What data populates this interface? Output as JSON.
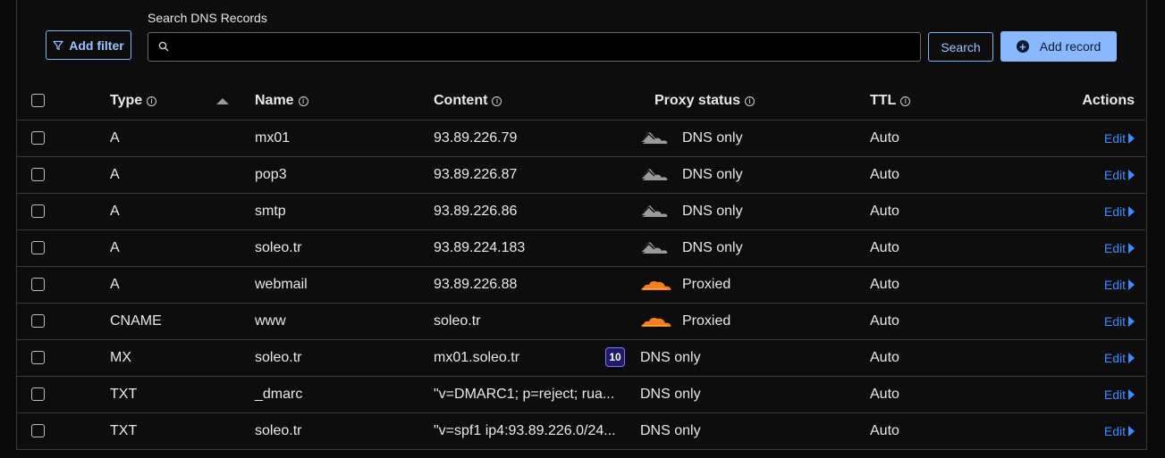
{
  "toolbar": {
    "search_label": "Search DNS Records",
    "filter_label": "Add filter",
    "search_button": "Search",
    "add_record_label": "Add record",
    "search_value": "",
    "search_placeholder": ""
  },
  "columns": {
    "type": "Type",
    "name": "Name",
    "content": "Content",
    "proxy_status": "Proxy status",
    "ttl": "TTL",
    "actions": "Actions"
  },
  "rows": [
    {
      "type": "A",
      "name": "mx01",
      "content": "93.89.226.79",
      "proxy": "DNS only",
      "proxy_icon": "cloud-gray",
      "ttl": "Auto",
      "action": "Edit"
    },
    {
      "type": "A",
      "name": "pop3",
      "content": "93.89.226.87",
      "proxy": "DNS only",
      "proxy_icon": "cloud-gray",
      "ttl": "Auto",
      "action": "Edit"
    },
    {
      "type": "A",
      "name": "smtp",
      "content": "93.89.226.86",
      "proxy": "DNS only",
      "proxy_icon": "cloud-gray",
      "ttl": "Auto",
      "action": "Edit"
    },
    {
      "type": "A",
      "name": "soleo.tr",
      "content": "93.89.224.183",
      "proxy": "DNS only",
      "proxy_icon": "cloud-gray",
      "ttl": "Auto",
      "action": "Edit"
    },
    {
      "type": "A",
      "name": "webmail",
      "content": "93.89.226.88",
      "proxy": "Proxied",
      "proxy_icon": "cloud-orange",
      "ttl": "Auto",
      "action": "Edit"
    },
    {
      "type": "CNAME",
      "name": "www",
      "content": "soleo.tr",
      "proxy": "Proxied",
      "proxy_icon": "cloud-orange",
      "ttl": "Auto",
      "action": "Edit"
    },
    {
      "type": "MX",
      "name": "soleo.tr",
      "content": "mx01.soleo.tr",
      "priority": "10",
      "proxy": "DNS only",
      "proxy_icon": "none",
      "ttl": "Auto",
      "action": "Edit"
    },
    {
      "type": "TXT",
      "name": "_dmarc",
      "content": "\"v=DMARC1; p=reject; rua...",
      "proxy": "DNS only",
      "proxy_icon": "none",
      "ttl": "Auto",
      "action": "Edit"
    },
    {
      "type": "TXT",
      "name": "soleo.tr",
      "content": "\"v=spf1 ip4:93.89.226.0/24...",
      "proxy": "DNS only",
      "proxy_icon": "none",
      "ttl": "Auto",
      "action": "Edit"
    }
  ],
  "colors": {
    "accent": "#8ab8ff",
    "link": "#3d8bff",
    "cloud_gray": "#9a9a9a",
    "cloud_orange": "#f38020"
  }
}
